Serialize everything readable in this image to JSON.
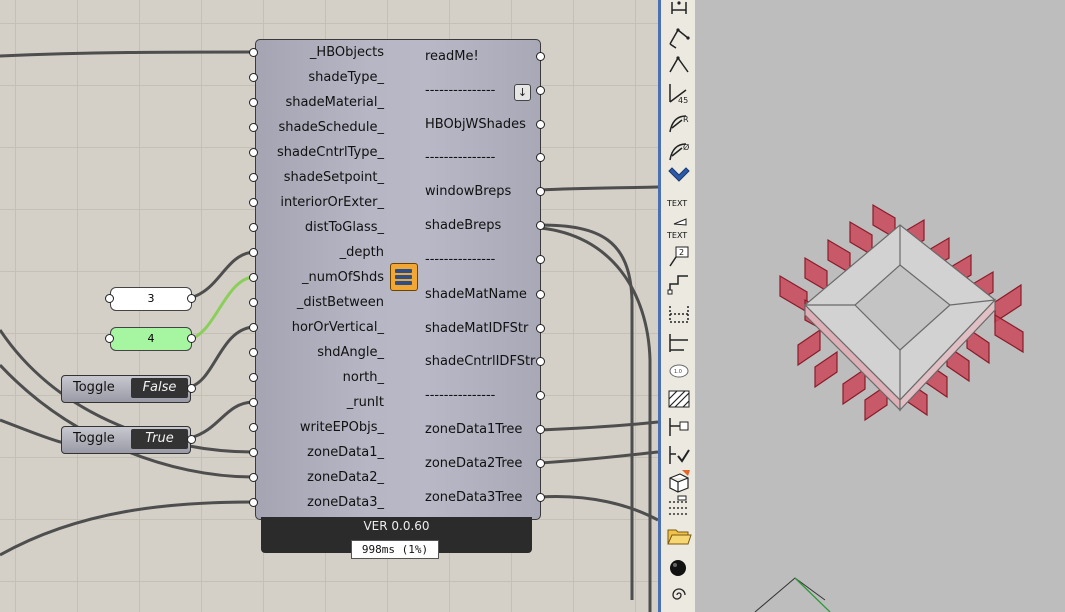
{
  "component": {
    "inputs": [
      "_HBObjects",
      "shadeType_",
      "shadeMaterial_",
      "shadeSchedule_",
      "shadeCntrlType_",
      "shadeSetpoint_",
      "interiorOrExter_",
      "distToGlass_",
      "_depth",
      "_numOfShds",
      "_distBetween",
      "horOrVertical_",
      "shdAngle_",
      "north_",
      "_runIt",
      "writeEPObjs_",
      "zoneData1_",
      "zoneData2_",
      "zoneData3_"
    ],
    "outputs": [
      "readMe!",
      "---------------",
      "HBObjWShades",
      "---------------",
      "windowBreps",
      "shadeBreps",
      "---------------",
      "shadeMatName",
      "shadeMatIDFStr",
      "shadeCntrlIDFStr",
      "---------------",
      "zoneData1Tree",
      "zoneData2Tree",
      "zoneData3Tree"
    ],
    "version": "VER 0.0.60",
    "timing": "998ms (1%)",
    "menu_icon": "down-arrow-icon",
    "center_icon": "honeybee-shading-icon"
  },
  "panels": [
    {
      "value": "3",
      "color": "#ffffff"
    },
    {
      "value": "4",
      "color": "#a6f5a0"
    }
  ],
  "toggles": [
    {
      "label": "Toggle",
      "value": "False"
    },
    {
      "label": "Toggle",
      "value": "True"
    }
  ],
  "toolbar": {
    "icons": [
      "dimension-icon",
      "aligned-dimension-icon",
      "angle-dimension-icon",
      "angle-45-icon",
      "radius-dimension-icon",
      "diameter-dimension-icon",
      "chevron-down-icon",
      "text-icon",
      "text-dot-icon",
      "leader-number-icon",
      "leader-icon",
      "linear-dimension-icon",
      "ordinate-dimension-icon",
      "annotation-dot-icon",
      "hatch-icon",
      "wire-leader-icon",
      "check-leader-icon",
      "box-edit-icon",
      "dotted-lines-icon",
      "open-folder-icon",
      "sphere-icon",
      "swirl-icon"
    ],
    "text_labels": [
      "TEXT",
      "TEXT"
    ]
  },
  "colors": {
    "canvas": "#d4d0c8",
    "toolbar_accent": "#4b6fb3",
    "viewport": "#bdbdbd",
    "shade_fin": "#c9485a",
    "box_face": "#cfcfcf"
  }
}
